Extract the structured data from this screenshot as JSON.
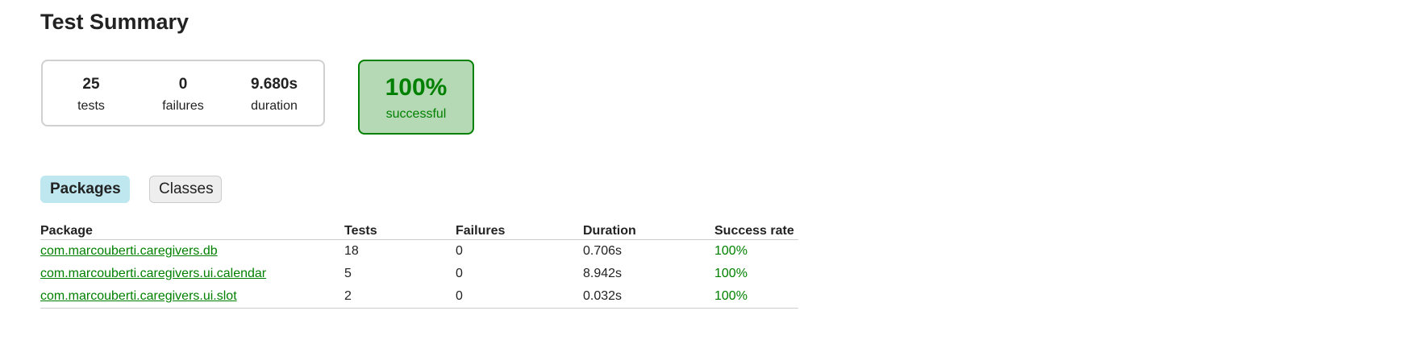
{
  "page_title": "Test Summary",
  "summary": {
    "tests": {
      "value": "25",
      "label": "tests"
    },
    "failures": {
      "value": "0",
      "label": "failures"
    },
    "duration": {
      "value": "9.680s",
      "label": "duration"
    }
  },
  "success": {
    "value": "100%",
    "label": "successful",
    "status_color": "#008000",
    "background": "#b5d9b5"
  },
  "tabs": [
    {
      "label": "Packages",
      "active": true
    },
    {
      "label": "Classes",
      "active": false
    }
  ],
  "table": {
    "headers": [
      "Package",
      "Tests",
      "Failures",
      "Duration",
      "Success rate"
    ],
    "rows": [
      {
        "package": "com.marcouberti.caregivers.db",
        "tests": "18",
        "failures": "0",
        "duration": "0.706s",
        "success_rate": "100%"
      },
      {
        "package": "com.marcouberti.caregivers.ui.calendar",
        "tests": "5",
        "failures": "0",
        "duration": "8.942s",
        "success_rate": "100%"
      },
      {
        "package": "com.marcouberti.caregivers.ui.slot",
        "tests": "2",
        "failures": "0",
        "duration": "0.032s",
        "success_rate": "100%"
      }
    ]
  },
  "colors": {
    "accent_green": "#008000",
    "tab_active_bg": "#bfe7ef"
  }
}
